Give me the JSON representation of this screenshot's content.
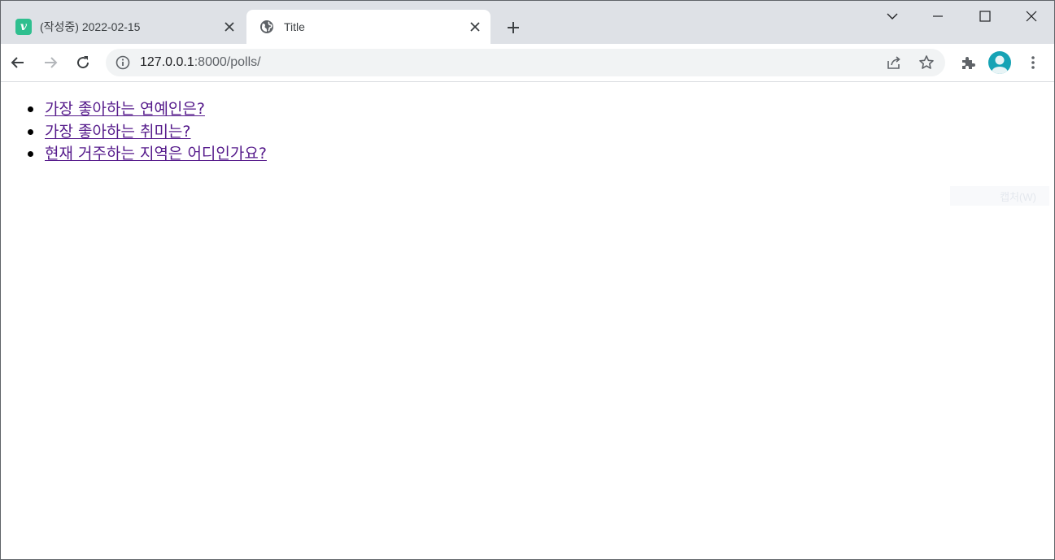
{
  "browser": {
    "tabs": [
      {
        "title": "(작성중) 2022-02-15",
        "favicon": "v",
        "active": false
      },
      {
        "title": "Title",
        "favicon": "globe-icon",
        "active": true
      }
    ],
    "new_tab_icon": "plus-icon",
    "window_controls": [
      "tab-search-icon",
      "minimize-icon",
      "maximize-icon",
      "close-icon"
    ],
    "address": {
      "host": "127.0.0.1",
      "path": ":8000/polls/"
    }
  },
  "polls": [
    {
      "question": "가장 좋아하는 연예인은?"
    },
    {
      "question": "가장 좋아하는 취미는?"
    },
    {
      "question": "현재 거주하는 지역은 어디인가요?"
    }
  ],
  "overlay": {
    "capture_label": "캡처(W)"
  },
  "colors": {
    "tabstrip": "#dee1e6",
    "omnibox": "#f1f3f4",
    "visited_link": "#551a8b",
    "favicon_v": "#2fbf8f",
    "avatar": "#16a3b5"
  }
}
